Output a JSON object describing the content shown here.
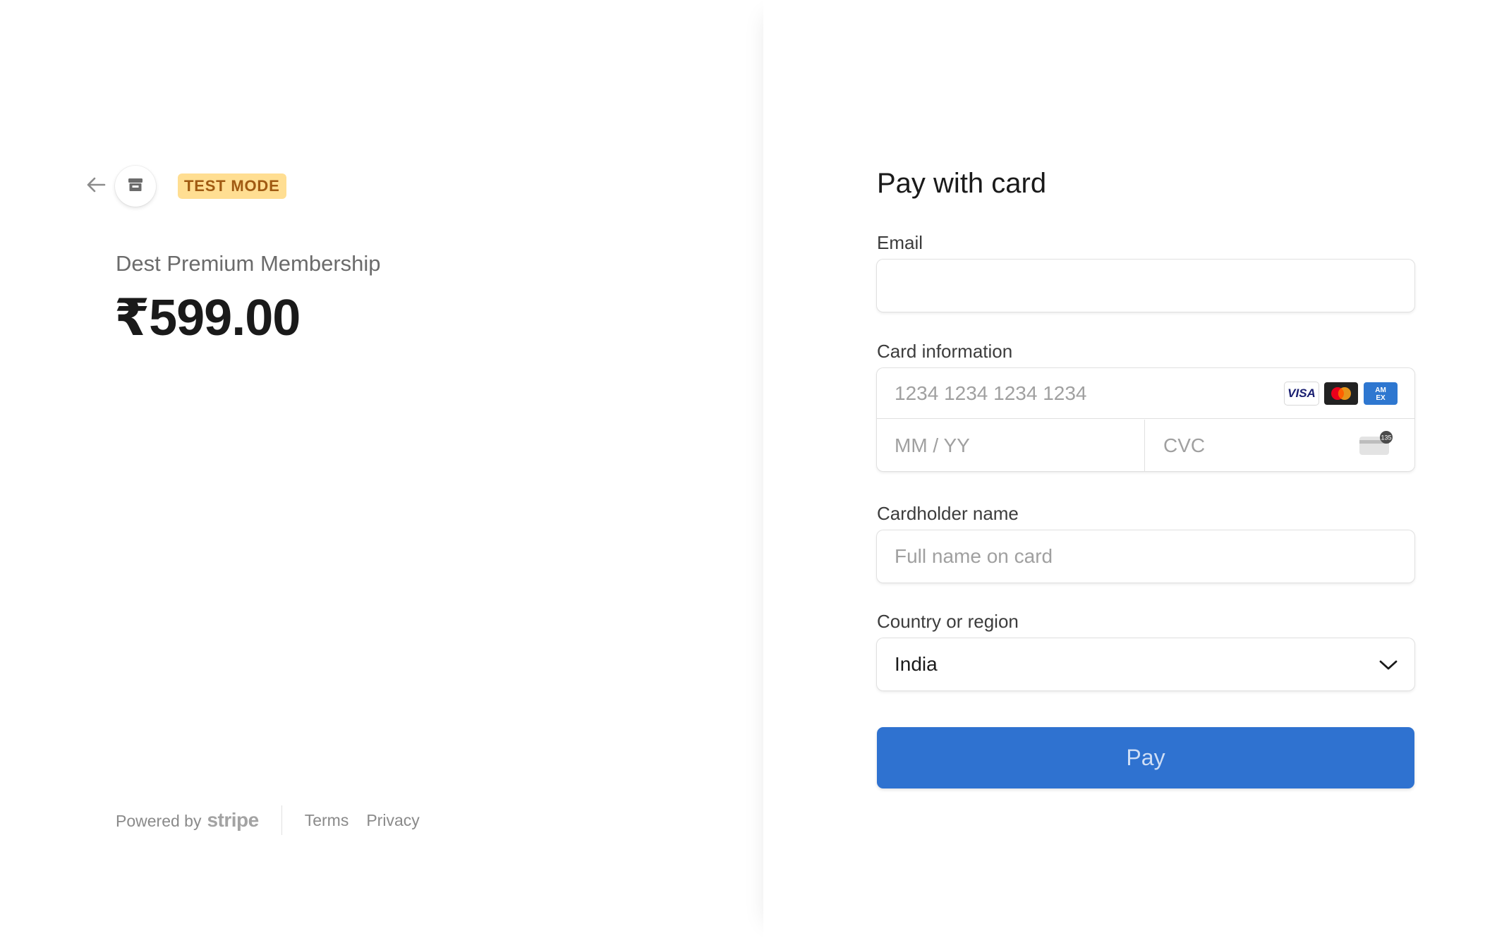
{
  "header": {
    "back_icon": "arrow-left-icon",
    "merchant_icon": "store-icon",
    "test_mode_label": "TEST MODE"
  },
  "product": {
    "name": "Dest Premium Membership",
    "price": "₹599.00"
  },
  "footer": {
    "powered_by": "Powered by",
    "brand": "stripe",
    "terms": "Terms",
    "privacy": "Privacy"
  },
  "form": {
    "title": "Pay with card",
    "email": {
      "label": "Email",
      "value": "",
      "placeholder": ""
    },
    "card": {
      "label": "Card information",
      "number_placeholder": "1234 1234 1234 1234",
      "expiry_placeholder": "MM / YY",
      "cvc_placeholder": "CVC",
      "brands": [
        "VISA",
        "mastercard",
        "AMEX"
      ],
      "cvc_icon": "card-cvc-icon",
      "cvc_icon_digits": "135"
    },
    "cardholder": {
      "label": "Cardholder name",
      "placeholder": "Full name on card"
    },
    "country": {
      "label": "Country or region",
      "value": "India",
      "icon": "chevron-down-icon"
    },
    "pay_button": "Pay"
  },
  "colors": {
    "accent": "#2f72d0",
    "badge_bg": "#ffde92",
    "badge_text": "#a05a12"
  }
}
